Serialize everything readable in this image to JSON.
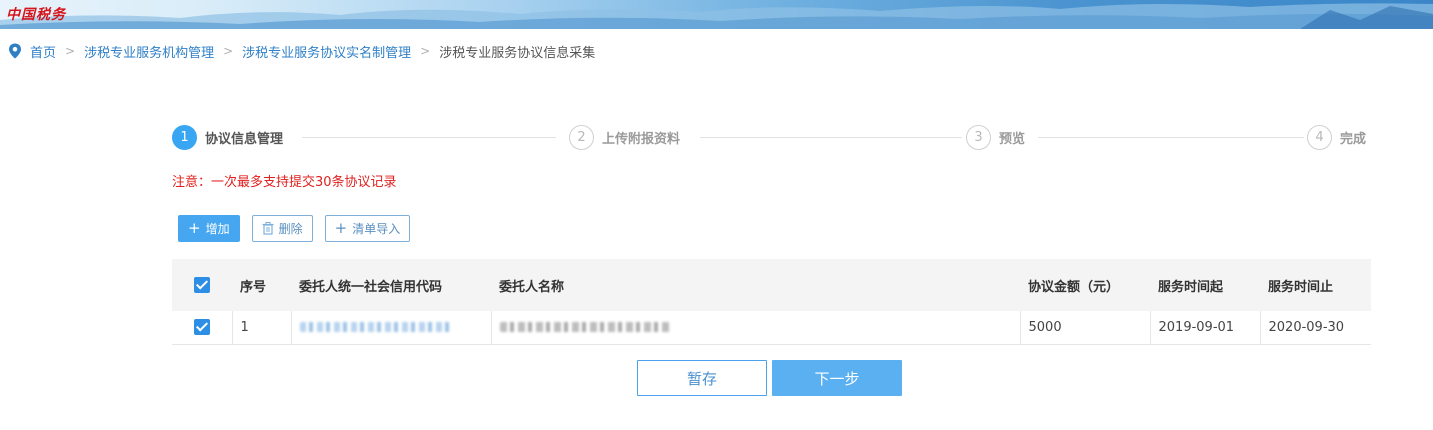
{
  "header": {
    "logo_text": "中国税务"
  },
  "breadcrumb": {
    "icon": "location-pin-icon",
    "items": [
      "首页",
      "涉税专业服务机构管理",
      "涉税专业服务协议实名制管理"
    ],
    "current": "涉税专业服务协议信息采集",
    "separator": ">"
  },
  "steps": [
    {
      "num": "1",
      "label": "协议信息管理",
      "active": true
    },
    {
      "num": "2",
      "label": "上传附报资料",
      "active": false
    },
    {
      "num": "3",
      "label": "预览",
      "active": false
    },
    {
      "num": "4",
      "label": "完成",
      "active": false
    }
  ],
  "notice": "注意：一次最多支持提交30条协议记录",
  "toolbar": {
    "add_label": "增加",
    "delete_label": "删除",
    "import_label": "清单导入",
    "add_icon": "plus-icon",
    "delete_icon": "trash-icon",
    "import_icon": "plus-icon"
  },
  "table": {
    "columns": [
      "序号",
      "委托人统一社会信用代码",
      "委托人名称",
      "协议金额（元）",
      "服务时间起",
      "服务时间止"
    ],
    "rows": [
      {
        "checked": true,
        "index": "1",
        "credit_code": "",
        "client_name": "",
        "amount": "5000",
        "start": "2019-09-01",
        "end": "2020-09-30"
      }
    ],
    "header_checked": true
  },
  "actions": {
    "save_label": "暂存",
    "next_label": "下一步"
  },
  "colors": {
    "primary": "#46a7f0",
    "link": "#2f7fc7",
    "notice": "#e0201e"
  }
}
